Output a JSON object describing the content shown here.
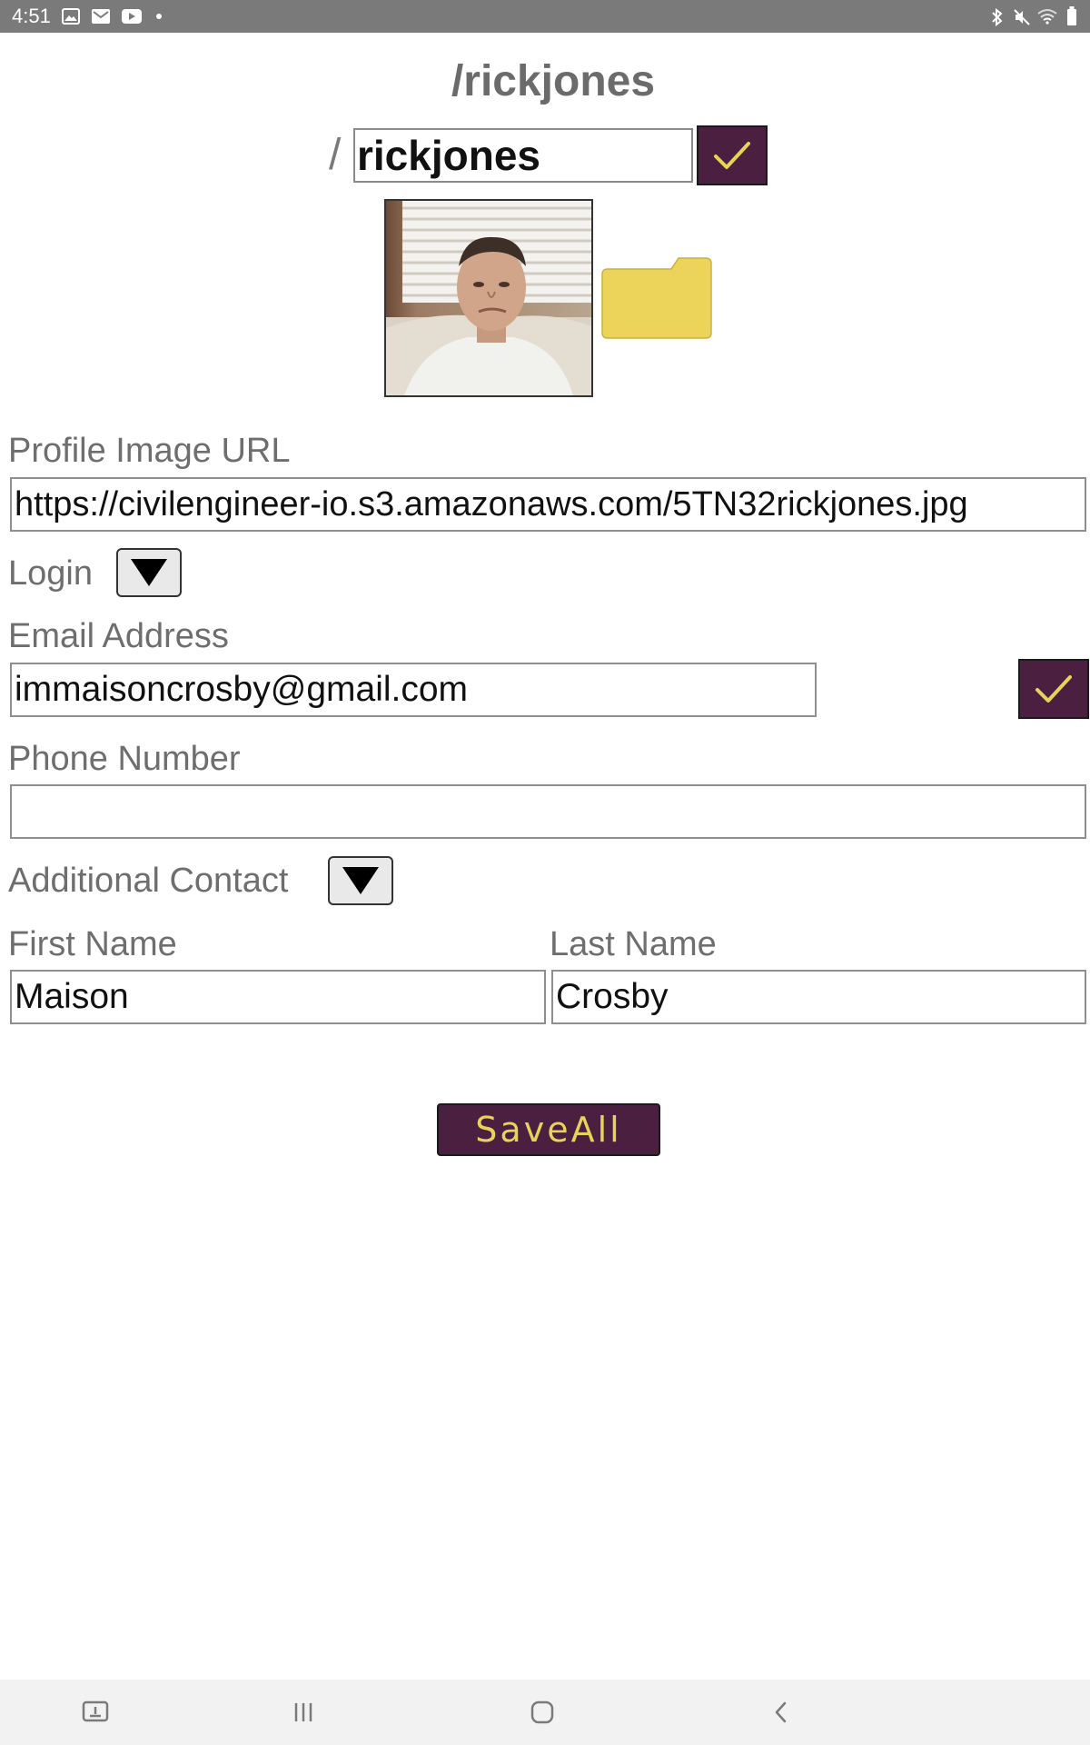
{
  "status_bar": {
    "time": "4:51",
    "left_icons": [
      "gallery-icon",
      "gmail-icon",
      "youtube-icon",
      "dot-icon"
    ],
    "right_icons": [
      "bluetooth-icon",
      "mute-icon",
      "wifi-icon",
      "battery-icon"
    ]
  },
  "header": {
    "title": "/rickjones",
    "slash": "/",
    "username_value": "rickjones"
  },
  "profile_image": {
    "url_label": "Profile Image URL",
    "url_value": "https://civilengineer-io.s3.amazonaws.com/5TN32rickjones.jpg"
  },
  "login": {
    "label": "Login",
    "email_label": "Email Address",
    "email_value": "immaisoncrosby@gmail.com",
    "phone_label": "Phone Number",
    "phone_value": ""
  },
  "additional_contact": {
    "label": "Additional Contact",
    "first_name_label": "First Name",
    "first_name_value": "Maison",
    "last_name_label": "Last Name",
    "last_name_value": "Crosby"
  },
  "actions": {
    "save_all_label": "SaveAll"
  },
  "colors": {
    "accent": "#4a1f3f",
    "check": "#e8d25a",
    "folder": "#ecd35a",
    "label_text": "#6e6e6e"
  },
  "nav_bar": {
    "icons": [
      "screenshot-icon",
      "recent-apps-icon",
      "home-icon",
      "back-icon"
    ]
  }
}
